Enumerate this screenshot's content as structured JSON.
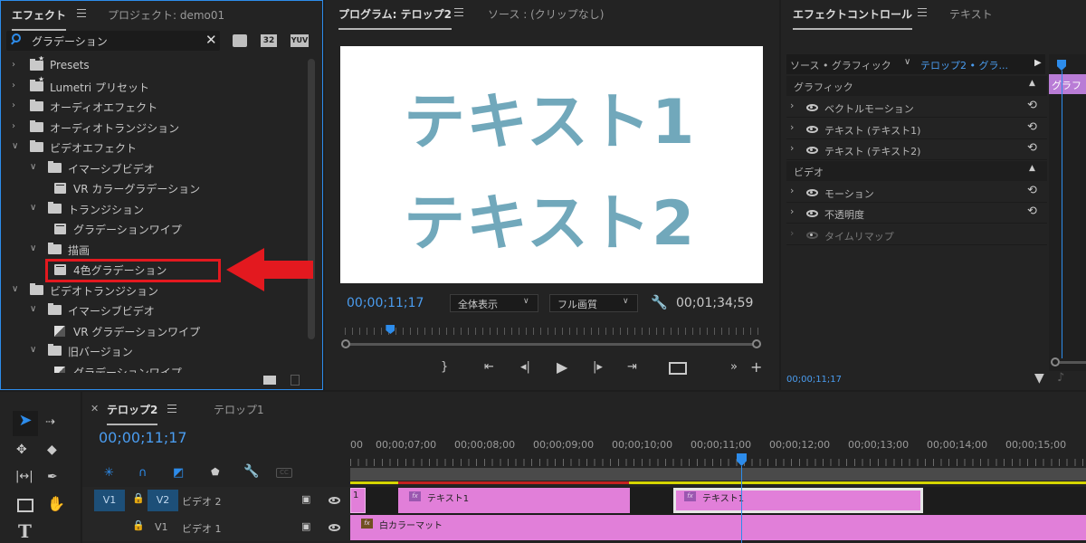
{
  "effects_panel": {
    "tabs": [
      "エフェクト",
      "プロジェクト: demo01"
    ],
    "search_value": "グラデーション",
    "toolbar_badges": [
      "32",
      "YUV"
    ],
    "tree": [
      {
        "label": "Presets",
        "kind": "folder-star",
        "level": 0,
        "expanded": false
      },
      {
        "label": "Lumetri プリセット",
        "kind": "folder-star",
        "level": 0,
        "expanded": false
      },
      {
        "label": "オーディオエフェクト",
        "kind": "folder",
        "level": 0,
        "expanded": false
      },
      {
        "label": "オーディオトランジション",
        "kind": "folder",
        "level": 0,
        "expanded": false
      },
      {
        "label": "ビデオエフェクト",
        "kind": "folder",
        "level": 0,
        "expanded": true
      },
      {
        "label": "イマーシブビデオ",
        "kind": "folder",
        "level": 1,
        "expanded": true
      },
      {
        "label": "VR カラーグラデーション",
        "kind": "effect",
        "level": 2
      },
      {
        "label": "トランジション",
        "kind": "folder",
        "level": 1,
        "expanded": true
      },
      {
        "label": "グラデーションワイプ",
        "kind": "effect",
        "level": 2
      },
      {
        "label": "描画",
        "kind": "folder",
        "level": 1,
        "expanded": true
      },
      {
        "label": "4色グラデーション",
        "kind": "effect",
        "level": 2,
        "highlighted": true
      },
      {
        "label": "ビデオトランジション",
        "kind": "folder",
        "level": 0,
        "expanded": true
      },
      {
        "label": "イマーシブビデオ",
        "kind": "folder",
        "level": 1,
        "expanded": true
      },
      {
        "label": "VR グラデーションワイプ",
        "kind": "transition",
        "level": 2
      },
      {
        "label": "旧バージョン",
        "kind": "folder",
        "level": 1,
        "expanded": true
      },
      {
        "label": "グラデーションワイプ",
        "kind": "transition",
        "level": 2
      }
    ]
  },
  "program_monitor": {
    "tabs": [
      "プログラム: テロップ2",
      "ソース : (クリップなし)"
    ],
    "preview_lines": [
      "テキスト1",
      "テキスト2"
    ],
    "current_time": "00;00;11;17",
    "zoom_select": "全体表示",
    "quality_select": "フル画質",
    "duration": "00;01;34;59",
    "playhead_fraction": 0.11
  },
  "effect_controls": {
    "tabs": [
      "エフェクトコントロール",
      "テキスト"
    ],
    "source_label": "ソース • グラフィック",
    "clip_label": "テロップ2 • グラ...",
    "clip_bar_label": "グラフ",
    "sections": [
      {
        "header": "グラフィック",
        "rows": [
          "ベクトルモーション",
          "テキスト (テキスト1)",
          "テキスト (テキスト2)"
        ]
      },
      {
        "header": "ビデオ",
        "rows": [
          "モーション",
          "不透明度",
          "タイムリマップ"
        ]
      }
    ],
    "time": "00;00;11;17"
  },
  "timeline": {
    "tabs": [
      "テロップ2",
      "テロップ1"
    ],
    "current_time": "00;00;11;17",
    "ruler": [
      "00",
      "00;00;07;00",
      "00;00;08;00",
      "00;00;09;00",
      "00;00;10;00",
      "00;00;11;00",
      "00;00;12;00",
      "00;00;13;00",
      "00;00;14;00",
      "00;00;15;00"
    ],
    "tracks": [
      {
        "src": "V1",
        "target": "V2",
        "name": "ビデオ 2"
      },
      {
        "src": "",
        "target": "V1",
        "name": "ビデオ 1"
      }
    ],
    "clips_v2": [
      {
        "label": "1"
      },
      {
        "label": "テキスト1"
      },
      {
        "label": "テキスト1"
      }
    ],
    "clip_v1": "白カラーマット"
  },
  "colors": {
    "accent_blue": "#2d8ceb",
    "clip_pink": "#e17fd9",
    "preview_text": "#71a8bb",
    "highlight_red": "#e3191f"
  }
}
